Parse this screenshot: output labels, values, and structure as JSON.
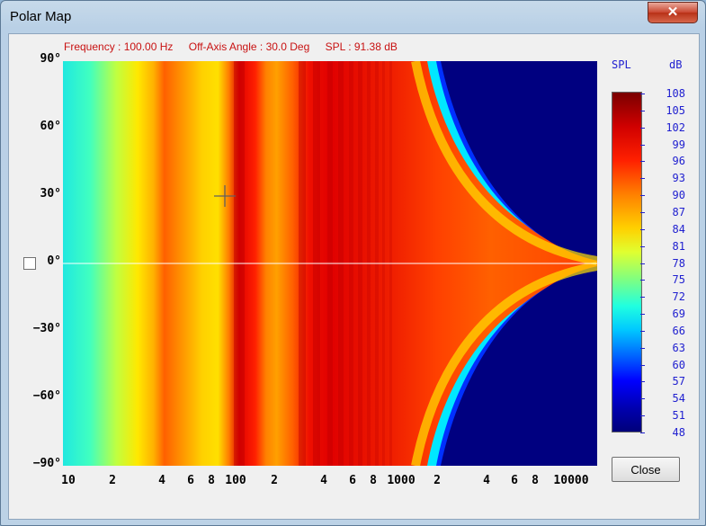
{
  "window": {
    "title": "Polar Map",
    "close_glyph": "✕"
  },
  "readout": {
    "frequency": "Frequency : 100.00 Hz",
    "angle": "Off-Axis Angle : 30.0 Deg",
    "spl": "SPL : 91.38 dB"
  },
  "y_axis": {
    "ticks": [
      "90°",
      "60°",
      "30°",
      "0°",
      "−30°",
      "−60°",
      "−90°"
    ]
  },
  "x_axis": {
    "ticks": [
      "10",
      "2",
      "4",
      "6",
      "8",
      "100",
      "2",
      "4",
      "6",
      "8",
      "1000",
      "2",
      "4",
      "6",
      "8",
      "10000"
    ]
  },
  "colorbar": {
    "title": "SPL",
    "unit": "dB",
    "labels": [
      "108",
      "105",
      "102",
      "99",
      "96",
      "93",
      "90",
      "87",
      "84",
      "81",
      "78",
      "75",
      "72",
      "69",
      "66",
      "63",
      "60",
      "57",
      "54",
      "51",
      "48"
    ]
  },
  "buttons": {
    "close": "Close"
  },
  "chart_data": {
    "type": "heatmap",
    "x_scale": "log",
    "x_range_hz": [
      10,
      20000
    ],
    "y_range_deg": [
      -90,
      90
    ],
    "cursor": {
      "frequency_hz": 100,
      "angle_deg": 30,
      "spl_db": 91.38
    },
    "z_range_db": [
      48,
      108
    ]
  }
}
